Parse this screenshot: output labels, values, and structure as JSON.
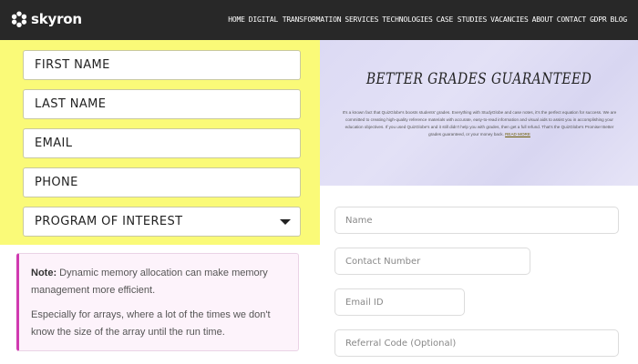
{
  "header": {
    "logo_text": "skyron",
    "logo_icon": "gear-flower-icon",
    "nav": [
      "HOME",
      "DIGITAL TRANSFORMATION",
      "SERVICES",
      "TECHNOLOGIES",
      "CASE STUDIES",
      "VACANCIES",
      "ABOUT",
      "CONTACT",
      "GDPR",
      "BLOG"
    ]
  },
  "left_form": {
    "background": "#fafa78",
    "first_name": "FIRST NAME",
    "last_name": "LAST NAME",
    "email": "EMAIL",
    "phone": "PHONE",
    "program": "PROGRAM OF INTEREST"
  },
  "note": {
    "label": "Note:",
    "line1": " Dynamic memory allocation can make memory management more efficient.",
    "line2": "Especially for arrays, where a lot of the times we don't know the size of the array until the run time.",
    "accent": "#d03ab0"
  },
  "banner": {
    "title": "BETTER GRADES GUARANTEED",
    "body": "It's a known fact that QuizGlobe's boosts students' grades. Everything with StudyGlobe and case notes, it's the perfect equation for success. We are committed to creating high-quality reference materials with accurate, easy-to-read information and visual aids to assist you in accomplishing your education objectives. If you used QuizGlobe's and it still didn't help you with grades, then get a full refund. That's the QuizGlobe's Promise! Better grades guaranteed, or your money back.",
    "link": "READ MORE"
  },
  "right_form": {
    "name_placeholder": "Name",
    "contact_placeholder": "Contact Number",
    "email_placeholder": "Email ID",
    "referral_placeholder": "Referral Code (Optional)"
  }
}
